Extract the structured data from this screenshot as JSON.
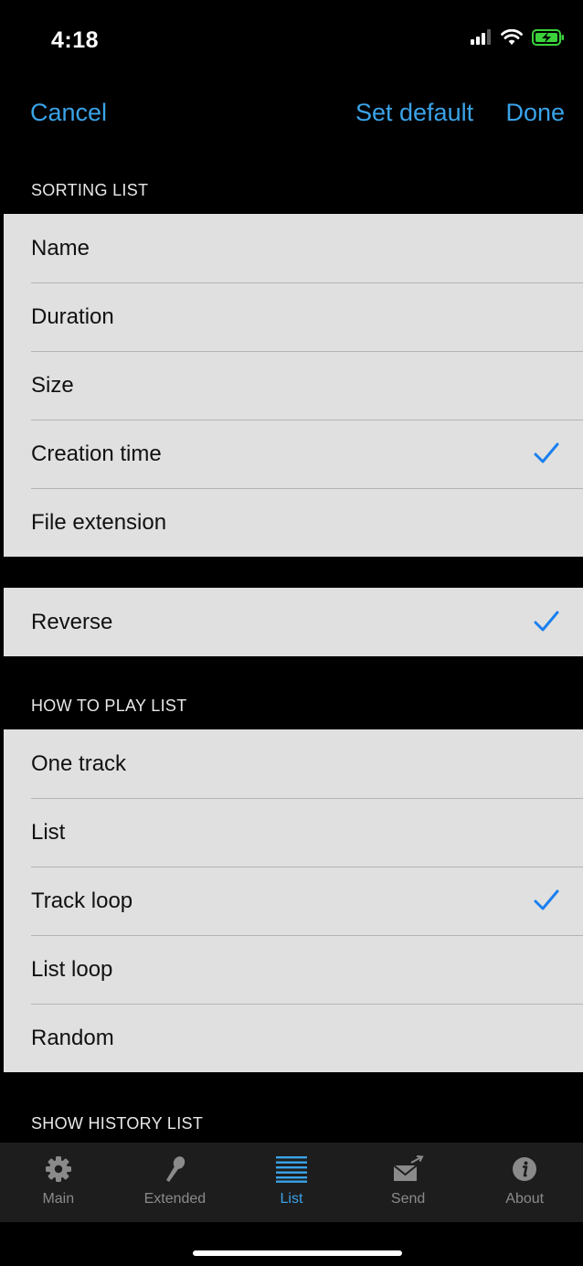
{
  "status_bar": {
    "time": "4:18"
  },
  "nav": {
    "cancel": "Cancel",
    "set_default": "Set default",
    "done": "Done"
  },
  "sorting": {
    "header": "SORTING LIST",
    "items": [
      {
        "label": "Name",
        "checked": false
      },
      {
        "label": "Duration",
        "checked": false
      },
      {
        "label": "Size",
        "checked": false
      },
      {
        "label": "Creation time",
        "checked": true
      },
      {
        "label": "File extension",
        "checked": false
      }
    ]
  },
  "reverse": {
    "label": "Reverse",
    "checked": true
  },
  "play": {
    "header": "HOW TO PLAY LIST",
    "items": [
      {
        "label": "One track",
        "checked": false
      },
      {
        "label": "List",
        "checked": false
      },
      {
        "label": "Track loop",
        "checked": true
      },
      {
        "label": "List loop",
        "checked": false
      },
      {
        "label": "Random",
        "checked": false
      }
    ]
  },
  "history": {
    "header": "SHOW HISTORY LIST"
  },
  "tabs": [
    {
      "label": "Main",
      "icon": "gear-icon"
    },
    {
      "label": "Extended",
      "icon": "microphone-icon"
    },
    {
      "label": "List",
      "icon": "list-icon",
      "active": true
    },
    {
      "label": "Send",
      "icon": "send-mail-icon"
    },
    {
      "label": "About",
      "icon": "info-icon"
    }
  ],
  "colors": {
    "accent": "#3aa3e8",
    "checkmark": "#1a7ff0",
    "row_bg": "#e0e0e0",
    "tab_inactive": "#8a8a8a"
  }
}
